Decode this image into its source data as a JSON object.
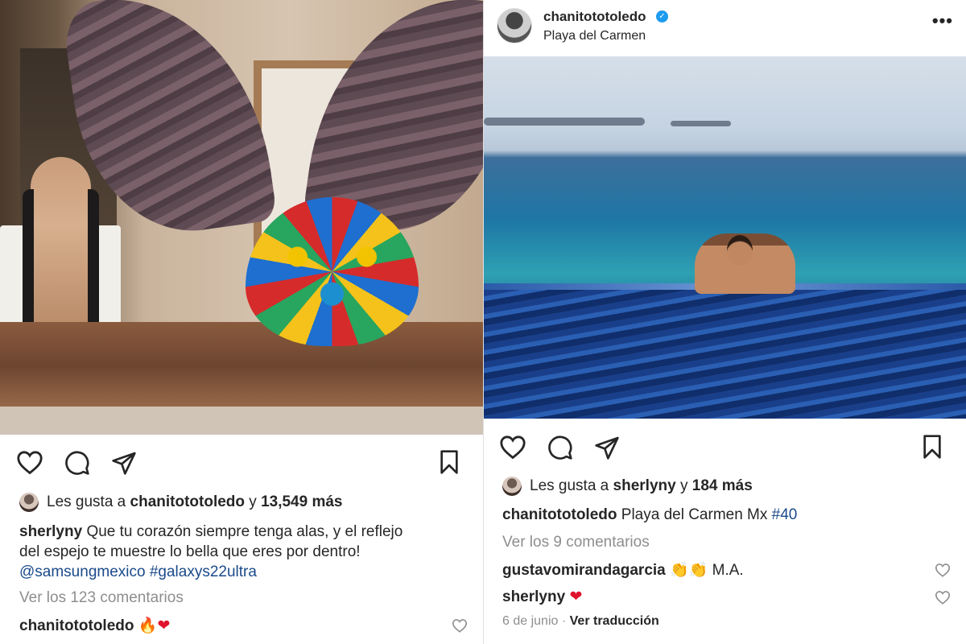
{
  "left_post": {
    "likes": {
      "prefix": "Les gusta a",
      "user": "chanitototoledo",
      "middle": "y",
      "count": "13,549 más"
    },
    "caption": {
      "user": "sherlyny",
      "line1": "Que tu corazón siempre tenga alas, y el reflejo",
      "line2": "del espejo te muestre lo bella que eres por dentro!",
      "tag1": "@samsungmexico",
      "tag2": "#galaxys22ultra"
    },
    "view_comments": "Ver los 123 comentarios",
    "comment": {
      "user": "chanitototoledo",
      "emoji1": "🔥",
      "emoji2": "❤"
    }
  },
  "right_post": {
    "header": {
      "username": "chanitototoledo",
      "location": "Playa del Carmen",
      "more": "•••",
      "verified": "✓"
    },
    "likes": {
      "prefix": "Les gusta a",
      "user": "sherlyny",
      "middle": "y",
      "count": "184 más"
    },
    "caption": {
      "user": "chanitototoledo",
      "text": "Playa del Carmen Mx",
      "tag": "#40"
    },
    "view_comments": "Ver los 9 comentarios",
    "comments": [
      {
        "user": "gustavomirandagarcia",
        "emoji": "👏👏",
        "text": "M.A."
      },
      {
        "user": "sherlyny",
        "emoji": "❤"
      }
    ],
    "date": "6 de junio",
    "translate": "Ver traducción"
  },
  "icons": {
    "like": "heart-outline-icon",
    "comment": "comment-bubble-icon",
    "share": "paper-plane-icon",
    "save": "bookmark-icon",
    "more": "more-dots-icon",
    "verified": "verified-badge-icon"
  }
}
